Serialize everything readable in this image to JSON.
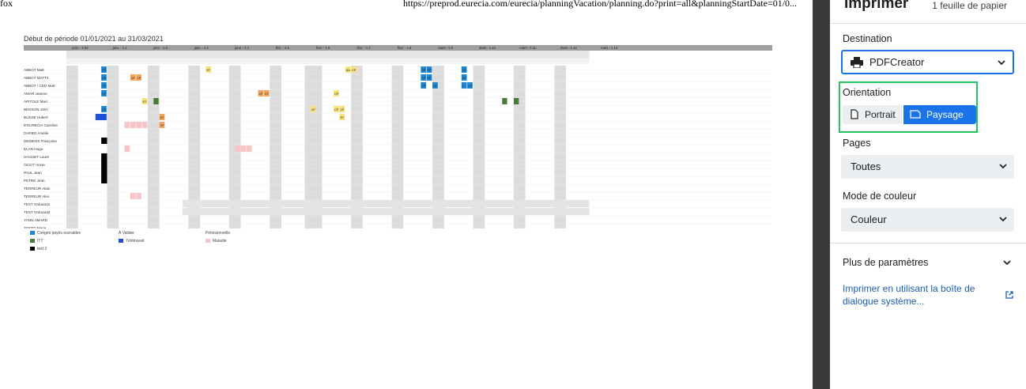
{
  "browser_header": {
    "title_fragment": "fox",
    "url": "https://preprod.eurecia.com/eurecia/planningVacation/planning.do?print=all&planningStartDate=01/0..."
  },
  "planning": {
    "period": "Début de période 01/01/2021 au 31/03/2021",
    "week_labels": [
      "janv. - s 53",
      "janv. - s 1",
      "janv. - s 2",
      "janv. - s 3",
      "janv. - s 4",
      "févr. - s 5",
      "févr. - s 6",
      "févr. - s 7",
      "févr. - s 8",
      "mars - s 9",
      "mars - s 10",
      "mars - s 11",
      "mars - s 12",
      "mars - s 13"
    ],
    "employees": [
      "ABBOT Matt",
      "ABBOT MATT3",
      "ABBOT / CDD Matt",
      "AMAR Jeanne",
      "APITOLE Marc",
      "BENSON John",
      "BUSSE Hubert",
      "D'EURECIA Caroline",
      "DARBO Amélie",
      "DESBOIS Françoise",
      "ELAN Hugo",
      "HAGUET Laure",
      "OCCIT Annie",
      "PAUL Jean",
      "PETRE Jean",
      "TERREUR Alain",
      "TERREUR Alex",
      "TEST Onboard1",
      "TEST Onboard2",
      "YANN AMARD",
      "ZOTTO Marie"
    ],
    "cells": {
      "cp": "CP",
      "an": "AN",
      "rt": "RT",
      "c": "C"
    },
    "colors": {
      "cp_blue": "#1e88d4",
      "cp_orange": "#f2a65a",
      "rt_yellow": "#f6e27a",
      "itt_green": "#4a7a3a",
      "sick_pink": "#f7c5c5",
      "black": "#000000",
      "tele_blue": "#1f4fd8",
      "weekend_grey": "#dcdcdc"
    }
  },
  "legend": {
    "conges": "Congés payés ouvrables",
    "itt": "ITT",
    "test2": "test 2",
    "a_valider": "À Valider",
    "teletravail": "Télétravail",
    "previsionnelle": "Prévisionnelle",
    "maladie": "Maladie"
  },
  "print_panel": {
    "title": "Imprimer",
    "sheet_count": "1 feuille de papier",
    "destination_label": "Destination",
    "destination_value": "PDFCreator",
    "orientation_label": "Orientation",
    "portrait_label": "Portrait",
    "landscape_label": "Paysage",
    "pages_label": "Pages",
    "pages_value": "Toutes",
    "color_label": "Mode de couleur",
    "color_value": "Couleur",
    "more_settings": "Plus de paramètres",
    "system_dialog_link": "Imprimer en utilisant la boîte de dialogue système...",
    "accent": "#1a73e8",
    "highlight": "#22c55e"
  }
}
